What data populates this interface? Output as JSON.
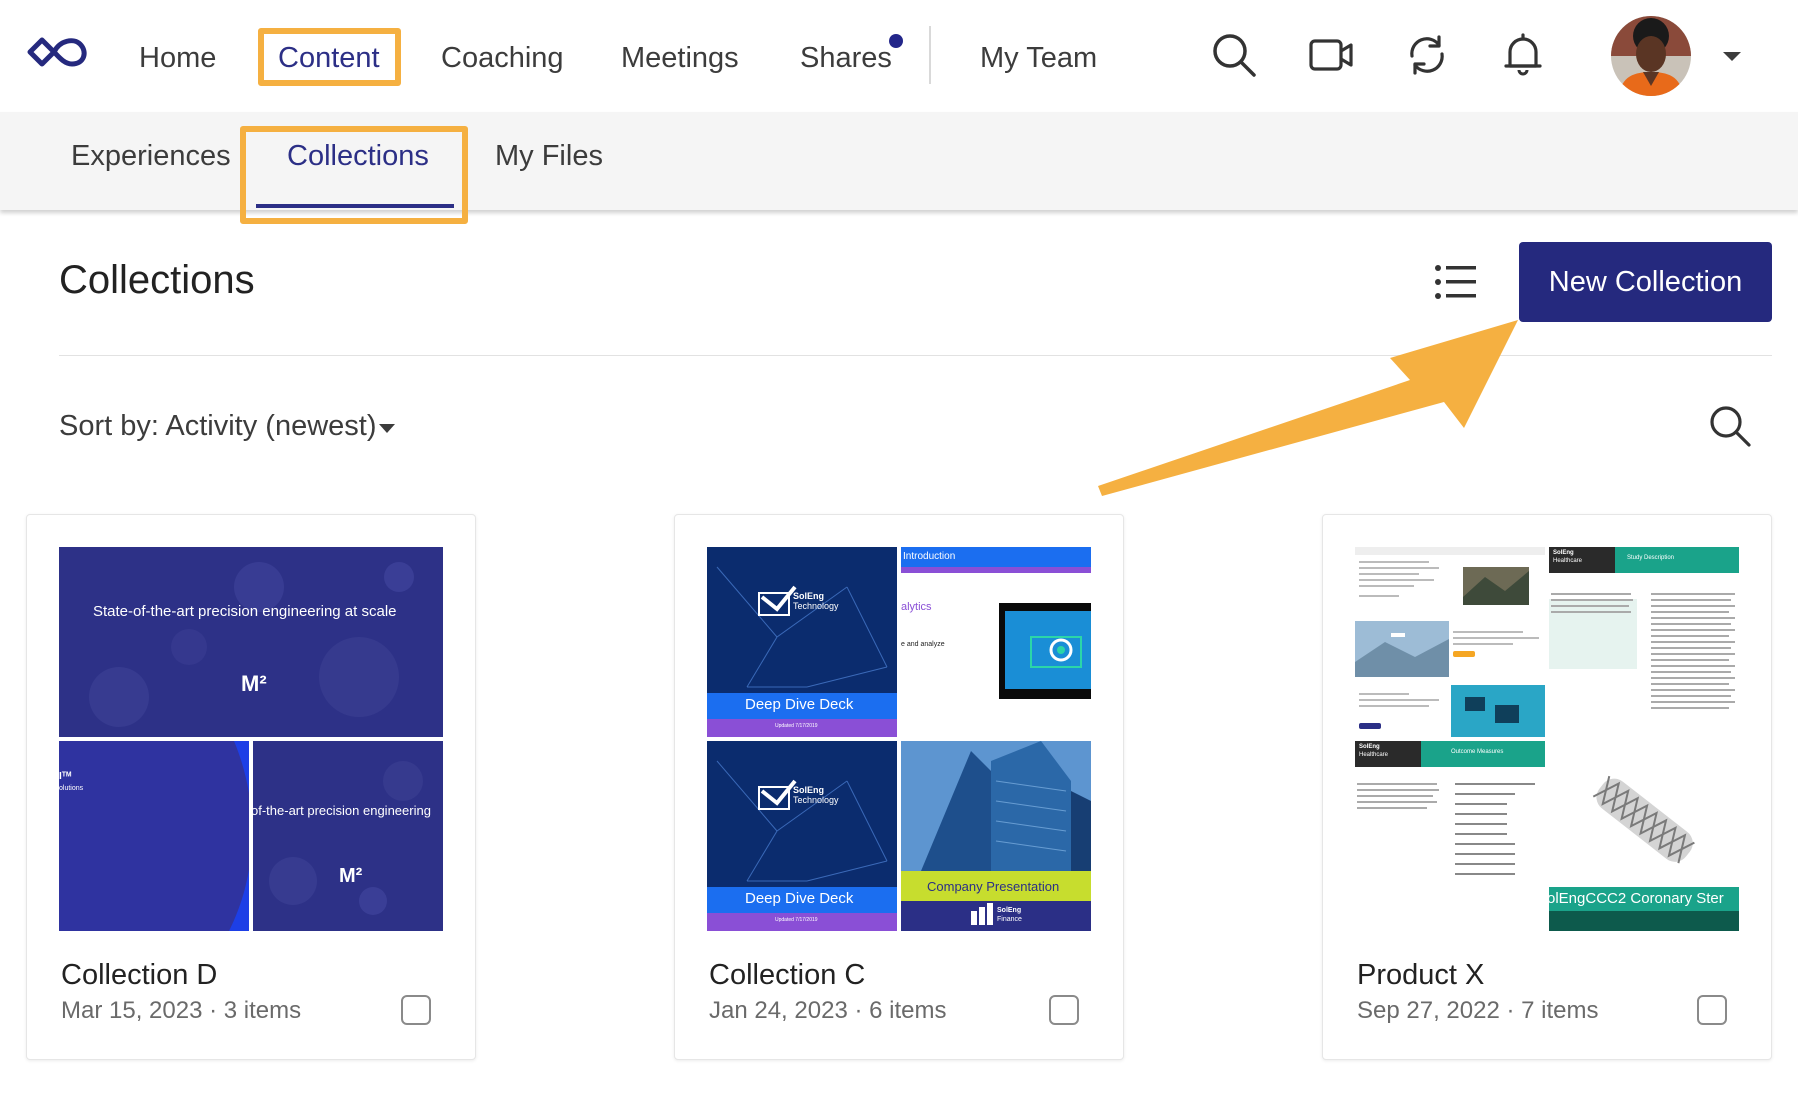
{
  "nav": {
    "items": [
      {
        "label": "Home"
      },
      {
        "label": "Content"
      },
      {
        "label": "Coaching"
      },
      {
        "label": "Meetings"
      },
      {
        "label": "Shares"
      },
      {
        "label": "My Team"
      }
    ],
    "active": "Content",
    "icons": [
      "search-icon",
      "video-camera-icon",
      "sync-icon",
      "bell-icon"
    ]
  },
  "subnav": {
    "tabs": [
      {
        "label": "Experiences"
      },
      {
        "label": "Collections"
      },
      {
        "label": "My Files"
      }
    ],
    "active": "Collections"
  },
  "page": {
    "title": "Collections",
    "new_button": "New Collection",
    "sort_label": "Sort by: Activity (newest)"
  },
  "cards": [
    {
      "title": "Collection D",
      "meta": "Mar 15, 2023 · 3 items",
      "thumbs": {
        "t1_text": "State-of-the-art precision engineering at scale",
        "t1_mark": "M²",
        "t2_text": "Iᵀᴹ",
        "t2_sub": "olutions",
        "t3_text": "of-the-art precision engineering",
        "t3_mark": "M²"
      }
    },
    {
      "title": "Collection C",
      "meta": "Jan 24, 2023 · 6 items",
      "thumbs": {
        "brand1": "SolEng",
        "brand2": "Technology",
        "deck": "Deep Dive Deck",
        "updated": "Updated 7/17/2019",
        "intro": "Introduction",
        "alytics": "alytics",
        "analyze": "e and analyze",
        "company": "Company Presentation",
        "fin1": "SolEng",
        "fin2": "Finance"
      }
    },
    {
      "title": "Product X",
      "meta": "Sep 27, 2022 · 7 items",
      "thumbs": {
        "brand1": "SolEng",
        "brand2": "Healthcare",
        "study": "Study Description",
        "outcome": "Outcome Measures",
        "stent": "olEngCCC2 Coronary Ster"
      }
    }
  ],
  "colors": {
    "accent": "#2c2f86",
    "button": "#25297e",
    "highlight": "#f5b041",
    "teal": "#1aa38a"
  }
}
